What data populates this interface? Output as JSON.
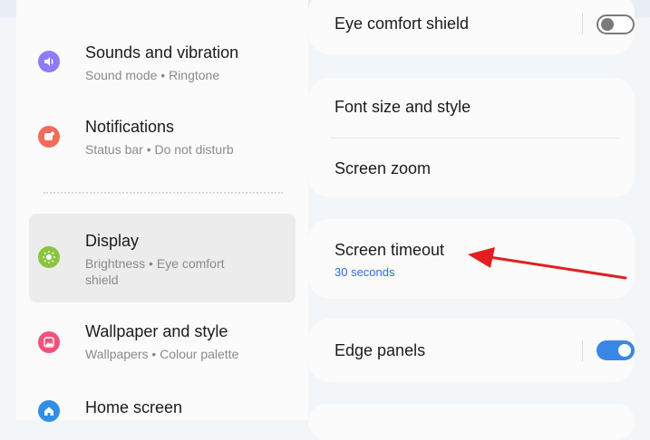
{
  "colors": {
    "accent": "#3a86e6",
    "arrow": "#e02020",
    "sounds_icon": "#8d7cf5",
    "notifications_icon": "#f26b5b",
    "display_icon": "#8bc53f",
    "wallpaper_icon": "#f0527a",
    "home_icon": "#2f8fe6"
  },
  "sidebar": {
    "items": [
      {
        "icon": "speaker-icon",
        "title": "Sounds and vibration",
        "subtitle": "Sound mode  •  Ringtone"
      },
      {
        "icon": "notification-icon",
        "title": "Notifications",
        "subtitle": "Status bar  •  Do not disturb"
      },
      {
        "icon": "brightness-icon",
        "title": "Display",
        "subtitle": "Brightness  •  Eye comfort shield",
        "selected": true
      },
      {
        "icon": "wallpaper-icon",
        "title": "Wallpaper and style",
        "subtitle": "Wallpapers  •  Colour palette"
      },
      {
        "icon": "home-icon",
        "title": "Home screen",
        "subtitle": ""
      }
    ]
  },
  "display_settings": {
    "eye_comfort": {
      "label": "Eye comfort shield",
      "enabled": false
    },
    "font_size": {
      "label": "Font size and style"
    },
    "screen_zoom": {
      "label": "Screen zoom"
    },
    "screen_timeout": {
      "label": "Screen timeout",
      "value": "30 seconds"
    },
    "edge_panels": {
      "label": "Edge panels",
      "enabled": true
    }
  }
}
